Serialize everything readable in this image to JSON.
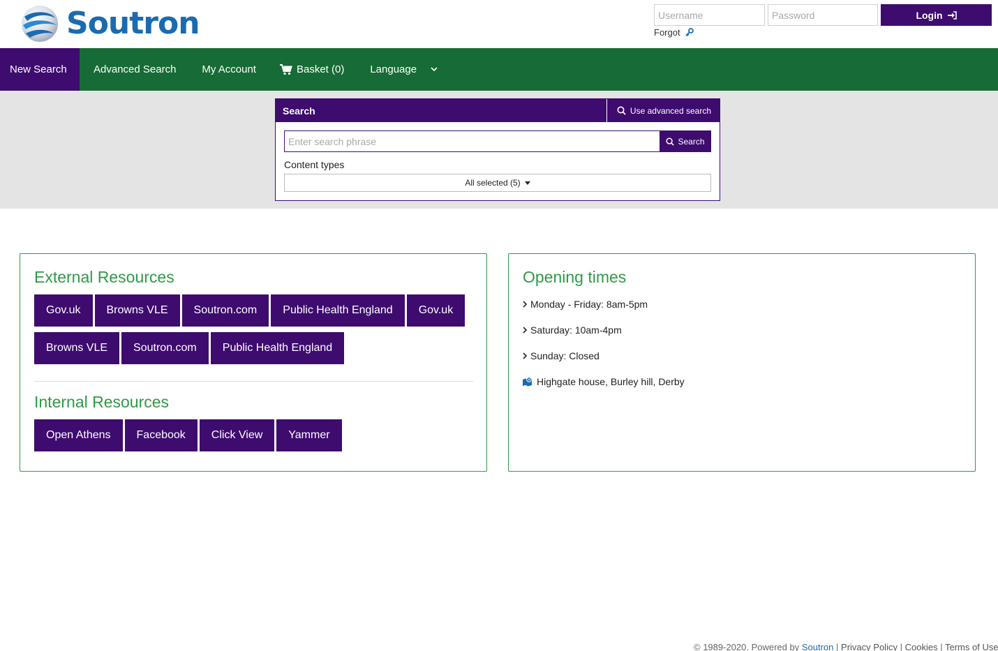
{
  "brand": {
    "name": "Soutron"
  },
  "login": {
    "username_placeholder": "Username",
    "password_placeholder": "Password",
    "login_label": "Login",
    "forgot_label": "Forgot"
  },
  "nav": {
    "items": [
      {
        "label": "New Search"
      },
      {
        "label": "Advanced Search"
      },
      {
        "label": "My Account"
      },
      {
        "label": "Basket (0)"
      },
      {
        "label": "Language"
      }
    ]
  },
  "search": {
    "title": "Search",
    "advanced_link": "Use advanced search",
    "input_placeholder": "Enter search phrase",
    "button_label": "Search",
    "content_types_label": "Content types",
    "content_types_value": "All selected (5)"
  },
  "external": {
    "title": "External Resources",
    "row1": [
      "Gov.uk",
      "Browns VLE",
      "Soutron.com",
      "Public Health England",
      "Gov.uk"
    ],
    "row2": [
      "Browns VLE",
      "Soutron.com",
      "Public Health England"
    ]
  },
  "internal": {
    "title": "Internal Resources",
    "buttons": [
      "Open Athens",
      "Facebook",
      "Click View",
      "Yammer"
    ]
  },
  "opening": {
    "title": "Opening times",
    "items": [
      "Monday - Friday: 8am-5pm",
      "Saturday: 10am-4pm",
      "Sunday: Closed"
    ],
    "address": "Highgate house, Burley hill, Derby"
  },
  "footer": {
    "copyright": "© 1989-2020. Powered by",
    "soutron_link": "Soutron",
    "privacy": "Privacy Policy",
    "cookies": "Cookies",
    "terms": "Terms of Use",
    "sep": "|"
  },
  "colors": {
    "purple": "#3e0b6f",
    "green_nav": "#176b36",
    "green_text": "#2e9a47",
    "brand_blue": "#1a6bb0"
  }
}
